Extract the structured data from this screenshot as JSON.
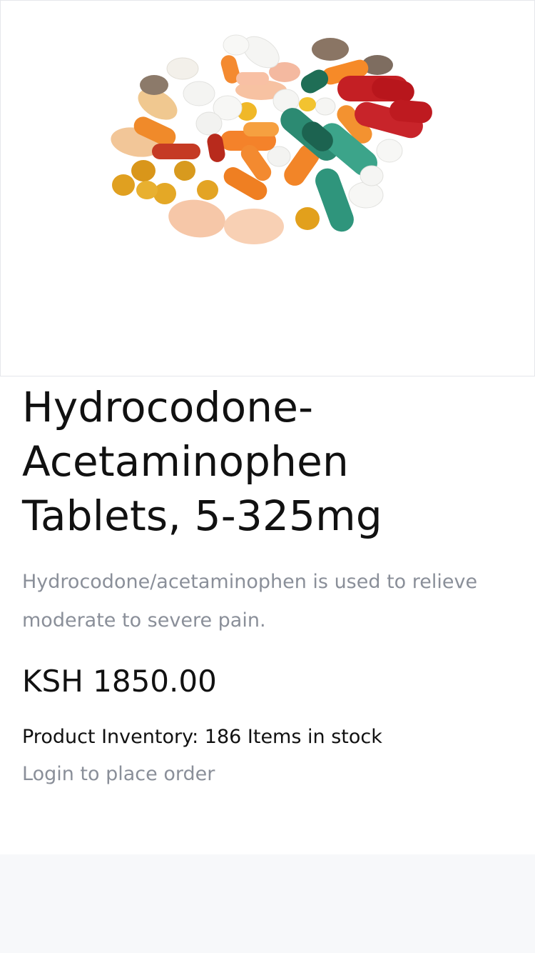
{
  "product": {
    "image_alt": "assorted pills and capsules",
    "title": "Hydrocodone-Acetaminophen Tablets, 5-325mg",
    "description": "Hydrocodone/acetaminophen is used to relieve moderate to severe pain.",
    "price": "KSH 1850.00",
    "inventory": "Product Inventory: 186 Items in stock",
    "login_text": "Login to place order"
  },
  "colors": {
    "text_primary": "#111111",
    "text_muted": "#8a8f99",
    "footer_bg": "#f7f8fa",
    "border": "#e5e7eb"
  }
}
